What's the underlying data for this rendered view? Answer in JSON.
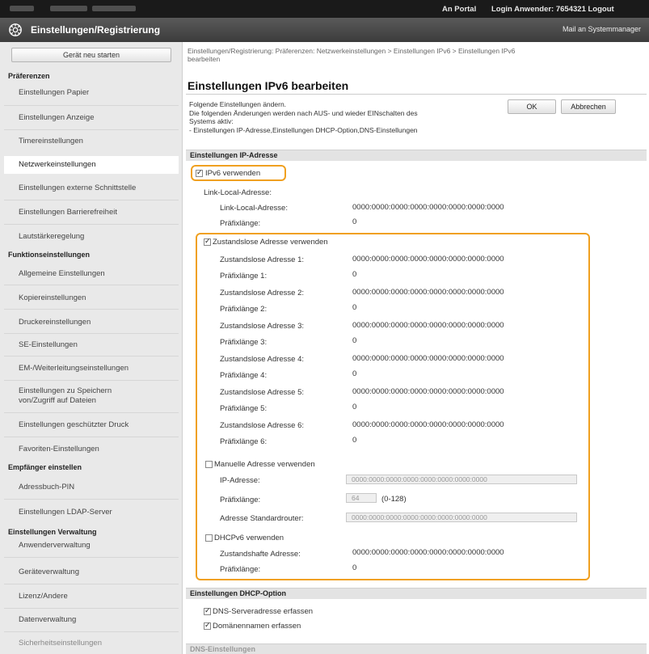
{
  "topbar": {
    "portal": "An Portal",
    "login": "Login Anwender:  7654321  Logout"
  },
  "titlebar": {
    "title": "Einstellungen/Registrierung",
    "mail": "Mail an Systemmanager"
  },
  "sidebar": {
    "restart": "Gerät neu starten",
    "groups": [
      {
        "head": "Präferenzen",
        "items": [
          "Einstellungen Papier",
          "Einstellungen Anzeige",
          "Timereinstellungen",
          "Netzwerkeinstellungen",
          "Einstellungen externe Schnittstelle",
          "Einstellungen Barrierefreiheit",
          "Lautstärkeregelung"
        ]
      },
      {
        "head": "Funktionseinstellungen",
        "items": [
          "Allgemeine Einstellungen",
          "Kopiereinstellungen",
          "Druckereinstellungen",
          "SE-Einstellungen",
          "EM-/Weiterleitungseinstellungen",
          "Einstellungen zu Speichern",
          "von/Zugriff auf Dateien",
          "Einstellungen geschützter Druck",
          "Favoriten-Einstellungen"
        ]
      },
      {
        "head": "Empfänger einstellen",
        "items": [
          "Adressbuch-PIN",
          "Einstellungen LDAP-Server"
        ]
      },
      {
        "head": "Einstellungen Verwaltung",
        "items": [
          "Anwenderverwaltung",
          "Geräteverwaltung",
          "Lizenz/Andere",
          "Datenverwaltung",
          "Sicherheitseinstellungen"
        ]
      }
    ]
  },
  "main": {
    "crumb_line1": "Einstellungen/Registrierung: Präferenzen: Netzwerkeinstellungen > Einstellungen IPv6 > Einstellungen IPv6",
    "crumb_line2": "bearbeiten",
    "title": "Einstellungen IPv6 bearbeiten",
    "desc": [
      "Folgende Einstellungen ändern.",
      "Die folgenden Änderungen werden nach AUS- und wieder EINschalten des",
      "Systems aktiv:",
      "- Einstellungen IP-Adresse,Einstellungen DHCP-Option,DNS-Einstellungen"
    ],
    "ok": "OK",
    "cancel": "Abbrechen",
    "sec_ip": "Einstellungen IP-Adresse",
    "use_ipv6": "IPv6 verwenden",
    "link_local_head": "Link-Local-Adresse:",
    "link_local_label": "Link-Local-Adresse:",
    "prefix_label": "Präfixlänge:",
    "addr_value": "0000:0000:0000:0000:0000:0000:0000:0000",
    "prefix_value": "0",
    "stateless_use": "Zustandslose Adresse verwenden",
    "stateless": [
      {
        "label": "Zustandslose Adresse 1:",
        "prefix": "Präfixlänge 1:"
      },
      {
        "label": "Zustandslose Adresse 2:",
        "prefix": "Präfixlänge 2:"
      },
      {
        "label": "Zustandslose Adresse 3:",
        "prefix": "Präfixlänge 3:"
      },
      {
        "label": "Zustandslose Adresse 4:",
        "prefix": "Präfixlänge 4:"
      },
      {
        "label": "Zustandslose Adresse 5:",
        "prefix": "Präfixlänge 5:"
      },
      {
        "label": "Zustandslose Adresse 6:",
        "prefix": "Präfixlänge 6:"
      }
    ],
    "manual_use": "Manuelle Adresse verwenden",
    "ip_label": "IP-Adresse:",
    "ip_value": "0000:0000:0000:0000:0000:0000:0000:0000",
    "manual_prefix_label": "Präfixlänge:",
    "manual_prefix_value": "64",
    "manual_prefix_range": "(0-128)",
    "router_label": "Adresse Standardrouter:",
    "router_value": "0000:0000:0000:0000:0000:0000:0000:0000",
    "dhcp_use": "DHCPv6 verwenden",
    "stateful_label": "Zustandshafte Adresse:",
    "stateful_prefix_label": "Präfixlänge:",
    "sec_dhcp": "Einstellungen DHCP-Option",
    "dns_server": "DNS-Serveradresse erfassen",
    "domain_name": "Domänennamen erfassen",
    "sec_dns": "DNS-Einstellungen"
  },
  "colors": {
    "highlight": "#f0a020",
    "topbar": "#1a1a1a",
    "titlebar": "#4a4a4a"
  }
}
